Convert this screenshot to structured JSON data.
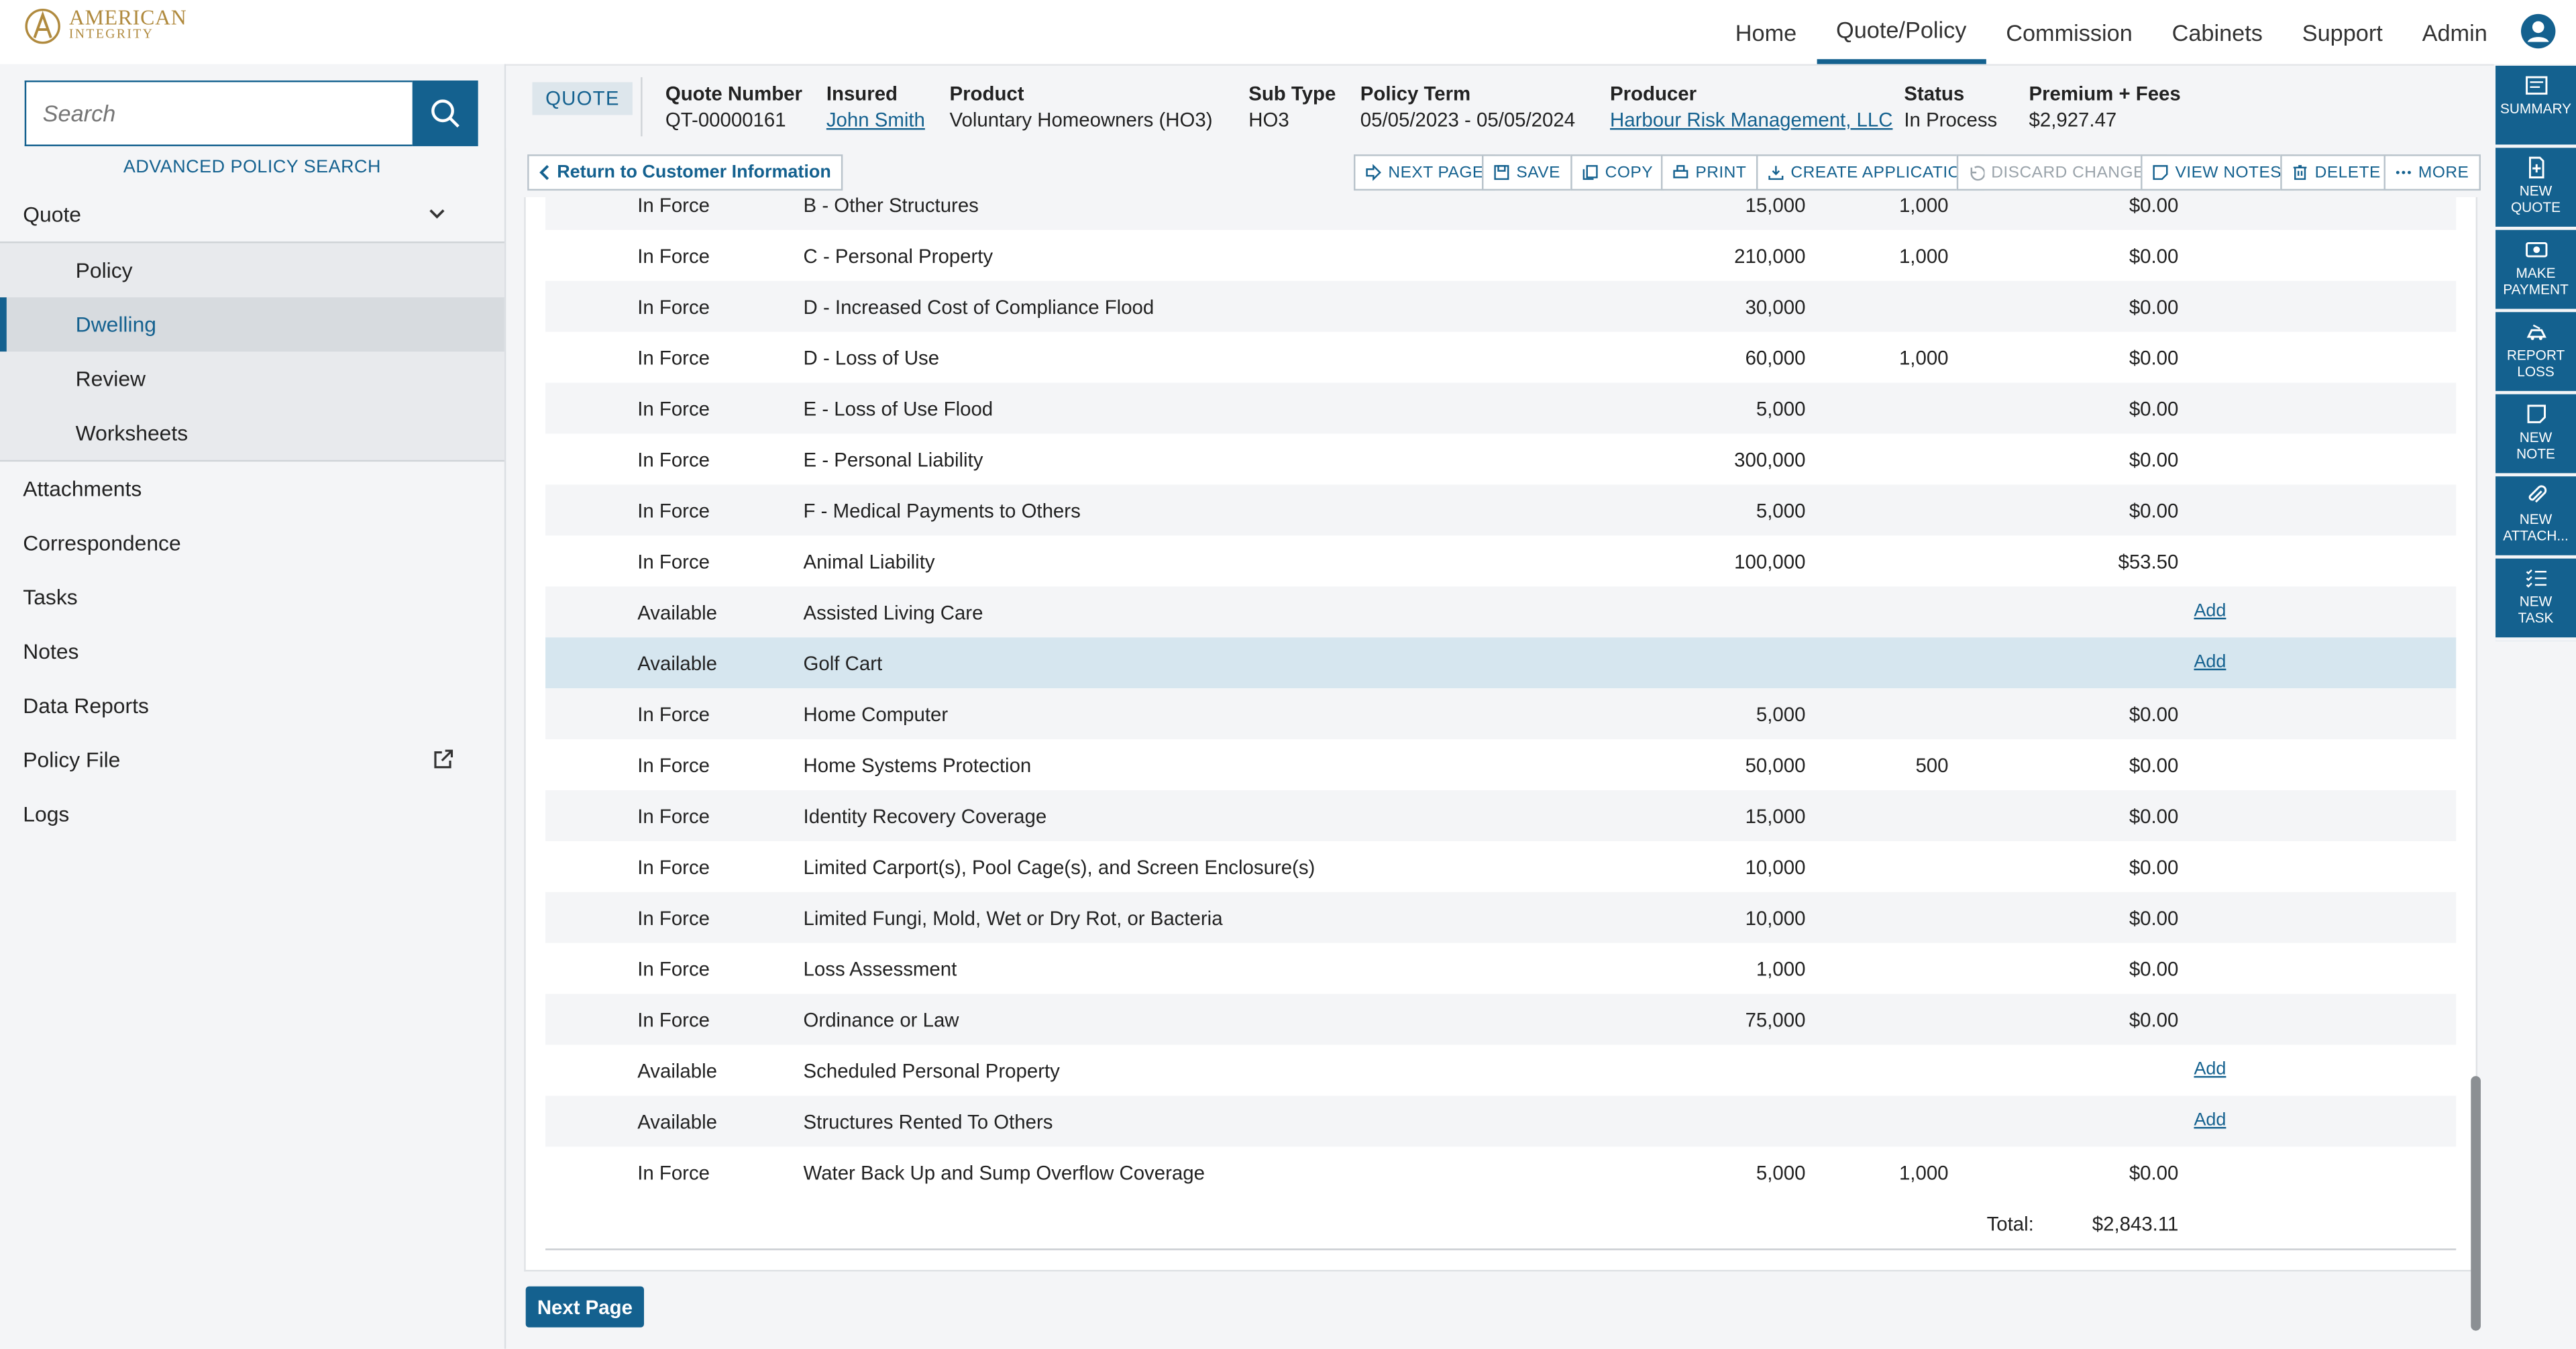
{
  "brand": {
    "line1": "AMERICAN",
    "line2": "INTEGRITY"
  },
  "nav": [
    {
      "label": "Home"
    },
    {
      "label": "Quote/Policy",
      "active": true
    },
    {
      "label": "Commission"
    },
    {
      "label": "Cabinets"
    },
    {
      "label": "Support"
    },
    {
      "label": "Admin"
    }
  ],
  "search": {
    "placeholder": "Search",
    "advanced": "ADVANCED POLICY SEARCH"
  },
  "sidebar": {
    "quote": "Quote",
    "sub": [
      "Policy",
      "Dwelling",
      "Review",
      "Worksheets"
    ],
    "active_sub": "Dwelling",
    "items": [
      "Attachments",
      "Correspondence",
      "Tasks",
      "Notes",
      "Data Reports",
      "Policy File",
      "Logs"
    ]
  },
  "header": {
    "badge": "QUOTE",
    "quote_number": {
      "k": "Quote Number",
      "v": "QT-00000161"
    },
    "insured": {
      "k": "Insured",
      "v": "John Smith"
    },
    "product": {
      "k": "Product",
      "v": "Voluntary Homeowners (HO3)"
    },
    "subtype": {
      "k": "Sub Type",
      "v": "HO3"
    },
    "term": {
      "k": "Policy Term",
      "v": "05/05/2023 - 05/05/2024"
    },
    "producer": {
      "k": "Producer",
      "v": "Harbour Risk Management, LLC"
    },
    "status": {
      "k": "Status",
      "v": "In Process"
    },
    "premium": {
      "k": "Premium + Fees",
      "v": "$2,927.47"
    }
  },
  "toolbar": {
    "back": "Return to Customer Information",
    "next_page": "NEXT PAGE",
    "save": "SAVE",
    "copy": "COPY",
    "print": "PRINT",
    "create_app": "CREATE APPLICATION",
    "discard": "DISCARD CHANGES",
    "view_notes": "VIEW NOTES",
    "delete": "DELETE",
    "more": "MORE"
  },
  "coverages": [
    {
      "status": "In Force",
      "name": "B - Other Structures",
      "limit": "15,000",
      "deductible": "1,000",
      "premium": "$0.00"
    },
    {
      "status": "In Force",
      "name": "C - Personal Property",
      "limit": "210,000",
      "deductible": "1,000",
      "premium": "$0.00"
    },
    {
      "status": "In Force",
      "name": "D - Increased Cost of Compliance Flood",
      "limit": "30,000",
      "deductible": "",
      "premium": "$0.00"
    },
    {
      "status": "In Force",
      "name": "D - Loss of Use",
      "limit": "60,000",
      "deductible": "1,000",
      "premium": "$0.00"
    },
    {
      "status": "In Force",
      "name": "E - Loss of Use Flood",
      "limit": "5,000",
      "deductible": "",
      "premium": "$0.00"
    },
    {
      "status": "In Force",
      "name": "E - Personal Liability",
      "limit": "300,000",
      "deductible": "",
      "premium": "$0.00"
    },
    {
      "status": "In Force",
      "name": "F - Medical Payments to Others",
      "limit": "5,000",
      "deductible": "",
      "premium": "$0.00"
    },
    {
      "status": "In Force",
      "name": "Animal Liability",
      "limit": "100,000",
      "deductible": "",
      "premium": "$53.50"
    },
    {
      "status": "Available",
      "name": "Assisted Living Care",
      "add": "Add"
    },
    {
      "status": "Available",
      "name": "Golf Cart",
      "add": "Add",
      "highlight": true
    },
    {
      "status": "In Force",
      "name": "Home Computer",
      "limit": "5,000",
      "deductible": "",
      "premium": "$0.00"
    },
    {
      "status": "In Force",
      "name": "Home Systems Protection",
      "limit": "50,000",
      "deductible": "500",
      "premium": "$0.00"
    },
    {
      "status": "In Force",
      "name": "Identity Recovery Coverage",
      "limit": "15,000",
      "deductible": "",
      "premium": "$0.00"
    },
    {
      "status": "In Force",
      "name": "Limited Carport(s), Pool Cage(s), and Screen Enclosure(s)",
      "limit": "10,000",
      "deductible": "",
      "premium": "$0.00"
    },
    {
      "status": "In Force",
      "name": "Limited Fungi, Mold, Wet or Dry Rot, or Bacteria",
      "limit": "10,000",
      "deductible": "",
      "premium": "$0.00"
    },
    {
      "status": "In Force",
      "name": "Loss Assessment",
      "limit": "1,000",
      "deductible": "",
      "premium": "$0.00"
    },
    {
      "status": "In Force",
      "name": "Ordinance or Law",
      "limit": "75,000",
      "deductible": "",
      "premium": "$0.00"
    },
    {
      "status": "Available",
      "name": "Scheduled Personal Property",
      "add": "Add"
    },
    {
      "status": "Available",
      "name": "Structures Rented To Others",
      "add": "Add"
    },
    {
      "status": "In Force",
      "name": "Water Back Up and Sump Overflow Coverage",
      "limit": "5,000",
      "deductible": "1,000",
      "premium": "$0.00"
    }
  ],
  "total": {
    "label": "Total:",
    "value": "$2,843.11"
  },
  "next_page_button": "Next Page",
  "rail": [
    {
      "l1": "SUMMARY",
      "l2": "",
      "icon": "summary-icon"
    },
    {
      "l1": "NEW",
      "l2": "QUOTE",
      "icon": "new-quote-icon"
    },
    {
      "l1": "MAKE",
      "l2": "PAYMENT",
      "icon": "payment-icon"
    },
    {
      "l1": "REPORT",
      "l2": "LOSS",
      "icon": "report-loss-icon"
    },
    {
      "l1": "NEW",
      "l2": "NOTE",
      "icon": "note-icon"
    },
    {
      "l1": "NEW",
      "l2": "ATTACH...",
      "icon": "attachment-icon"
    },
    {
      "l1": "NEW",
      "l2": "TASK",
      "icon": "task-icon"
    }
  ],
  "colors": {
    "primary": "#14618f",
    "highlight_row": "#d6e6ef",
    "brand_gold": "#b08a3e"
  }
}
